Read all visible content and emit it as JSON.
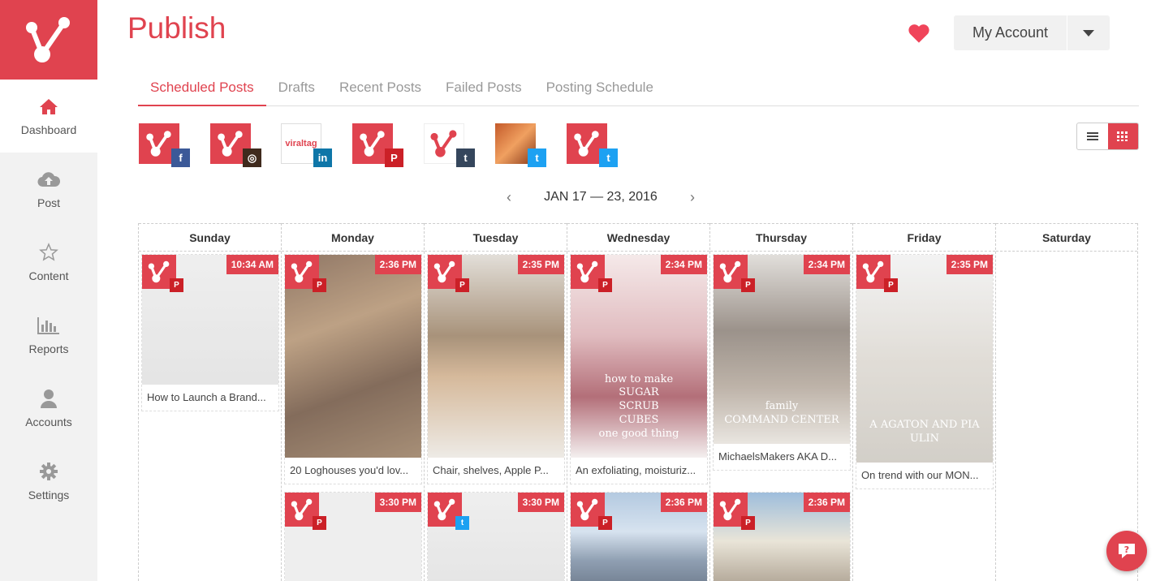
{
  "app": {
    "title": "Publish",
    "brand_color": "#e0434f"
  },
  "sidebar": {
    "items": [
      {
        "label": "Dashboard",
        "icon": "home-icon"
      },
      {
        "label": "Post",
        "icon": "cloud-upload-icon"
      },
      {
        "label": "Content",
        "icon": "star-icon"
      },
      {
        "label": "Reports",
        "icon": "bar-chart-icon"
      },
      {
        "label": "Accounts",
        "icon": "user-icon"
      },
      {
        "label": "Settings",
        "icon": "gear-icon"
      }
    ]
  },
  "header": {
    "account_label": "My Account"
  },
  "tabs": [
    "Scheduled Posts",
    "Drafts",
    "Recent Posts",
    "Failed Posts",
    "Posting Schedule"
  ],
  "accounts": [
    {
      "network": "facebook",
      "badge": "f",
      "badge_color": "#3b5998"
    },
    {
      "network": "instagram",
      "badge": "◎",
      "badge_color": "#3f2a1d"
    },
    {
      "network": "linkedin",
      "badge": "in",
      "badge_color": "#0e76a8",
      "logo_text": "viraltag"
    },
    {
      "network": "pinterest",
      "badge": "P",
      "badge_color": "#cb2027"
    },
    {
      "network": "tumblr",
      "badge": "t",
      "badge_color": "#35465c"
    },
    {
      "network": "twitter",
      "badge": "t",
      "badge_color": "#1da1f2"
    },
    {
      "network": "twitter",
      "badge": "t",
      "badge_color": "#1da1f2"
    }
  ],
  "date_range": "JAN 17 — 23, 2016",
  "days": [
    "Sunday",
    "Monday",
    "Tuesday",
    "Wednesday",
    "Thursday",
    "Friday",
    "Saturday"
  ],
  "posts": [
    {
      "day": 0,
      "time": "10:34 AM",
      "caption": "How to Launch a Brand...",
      "network": "pinterest",
      "img": "person"
    },
    {
      "day": 1,
      "time": "2:36 PM",
      "caption": "20 Loghouses you'd lov...",
      "network": "pinterest",
      "img": "loghouse"
    },
    {
      "day": 1,
      "time": "3:30 PM",
      "caption": "",
      "network": "pinterest",
      "img": "plain"
    },
    {
      "day": 2,
      "time": "2:35 PM",
      "caption": "Chair, shelves, Apple P...",
      "network": "pinterest",
      "img": "shelves"
    },
    {
      "day": 2,
      "time": "3:30 PM",
      "caption": "",
      "network": "twitter",
      "img": "person"
    },
    {
      "day": 3,
      "time": "2:34 PM",
      "caption": "An exfoliating, moisturiz...",
      "network": "pinterest",
      "img": "sugar",
      "overlay": [
        "how to make",
        "SUGAR",
        "SCRUB",
        "CUBES",
        "one good thing"
      ]
    },
    {
      "day": 3,
      "time": "2:36 PM",
      "caption": "",
      "network": "pinterest",
      "img": "mountains"
    },
    {
      "day": 4,
      "time": "2:34 PM",
      "caption": "MichaelsMakers AKA D...",
      "network": "pinterest",
      "img": "command",
      "overlay": [
        "family",
        "COMMAND CENTER"
      ]
    },
    {
      "day": 4,
      "time": "2:36 PM",
      "caption": "",
      "network": "pinterest",
      "img": "sky"
    },
    {
      "day": 5,
      "time": "2:35 PM",
      "caption": "On trend with our MON...",
      "network": "pinterest",
      "img": "desk",
      "overlay": [
        "A AGATON AND PIA ULIN"
      ]
    }
  ]
}
